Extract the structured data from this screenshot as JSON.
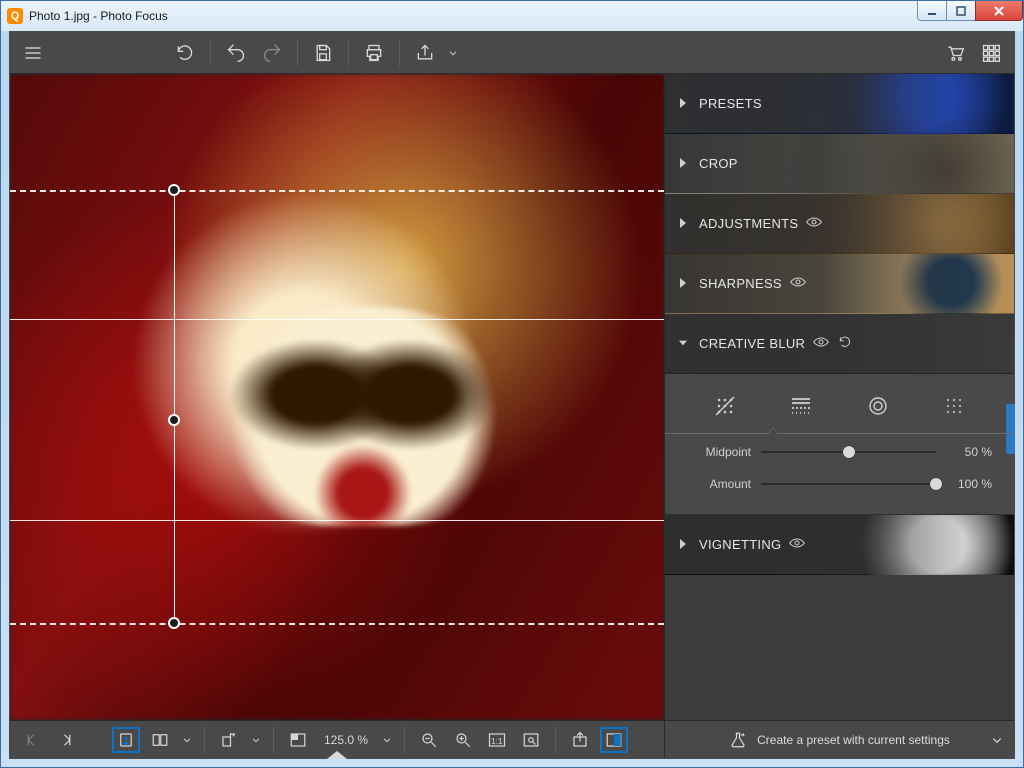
{
  "window": {
    "title": "Photo 1.jpg - Photo Focus",
    "app_icon_letter": "Q"
  },
  "toolbar": {
    "menu": "menu",
    "undo_all": "undo-all",
    "undo": "undo",
    "redo": "redo",
    "save": "save",
    "print": "print",
    "share": "share",
    "cart": "cart",
    "grid": "grid"
  },
  "panels": {
    "presets": {
      "label": "PRESETS"
    },
    "crop": {
      "label": "CROP"
    },
    "adjust": {
      "label": "ADJUSTMENTS"
    },
    "sharp": {
      "label": "SHARPNESS"
    },
    "cblur": {
      "label": "CREATIVE BLUR"
    },
    "vign": {
      "label": "VIGNETTING"
    }
  },
  "creative_blur": {
    "modes": [
      "none",
      "linear",
      "radial",
      "grid"
    ],
    "active_mode_index": 1,
    "sliders": {
      "midpoint": {
        "label": "Midpoint",
        "value": 50,
        "display": "50 %"
      },
      "amount": {
        "label": "Amount",
        "value": 100,
        "display": "100 %"
      }
    }
  },
  "bottom": {
    "zoom_display": "125.0 %",
    "preset_button": "Create a preset with current settings"
  }
}
